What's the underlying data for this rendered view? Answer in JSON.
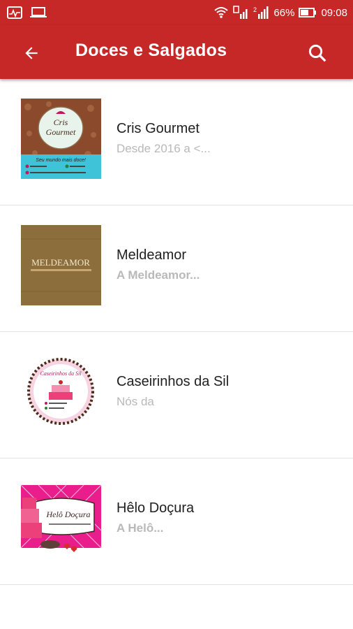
{
  "status_bar": {
    "battery": "66%",
    "time": "09:08"
  },
  "app_bar": {
    "title": "Doces e Salgados"
  },
  "items": [
    {
      "name": "Cris Gourmet",
      "desc": "Desde 2016 a <...",
      "thumb": {
        "logo_line1": "Cris",
        "logo_line2": "Gourmet",
        "tagline": "Seu mundo mais doce!"
      }
    },
    {
      "name": "Meldeamor",
      "desc": "A Meldeamor...",
      "thumb": {
        "logo": "MELDEAMOR"
      }
    },
    {
      "name": "Caseirinhos da Sil",
      "desc": "Nós da",
      "thumb": {
        "logo": "Caseirinhos da Sil"
      }
    },
    {
      "name": "Hêlo Doçura",
      "desc": "A Helô...",
      "thumb": {
        "logo": "Helô Doçura"
      }
    }
  ]
}
